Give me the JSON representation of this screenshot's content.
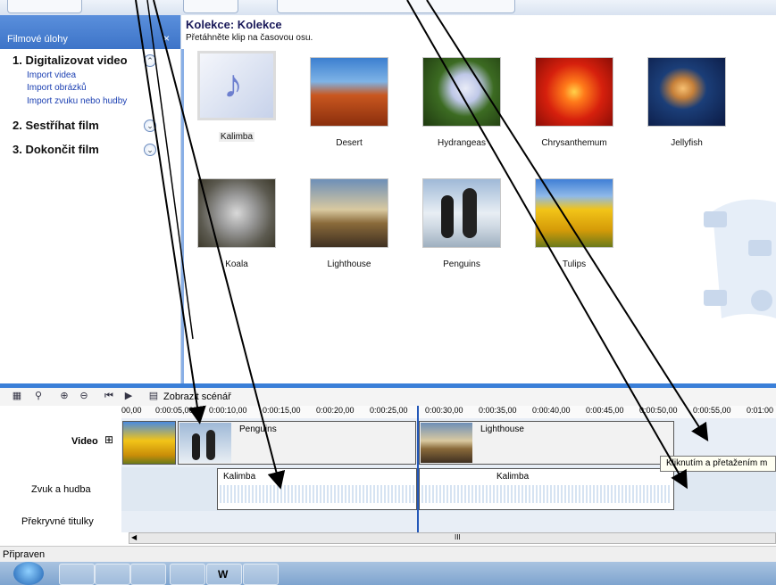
{
  "task_pane": {
    "header": "Filmové úlohy",
    "close": "×",
    "sections": [
      {
        "title": "1. Digitalizovat video",
        "toggle": "⌃",
        "links": [
          "Import videa",
          "Import obrázků",
          "Import zvuku nebo hudby"
        ]
      },
      {
        "title": "2. Sestříhat film",
        "toggle": "⌄"
      },
      {
        "title": "3. Dokončit film",
        "toggle": "⌄"
      }
    ]
  },
  "collection": {
    "title": "Kolekce: Kolekce",
    "subtitle": "Přetáhněte klip na časovou osu.",
    "clips": [
      "Kalimba",
      "Desert",
      "Hydrangeas",
      "Chrysanthemum",
      "Jellyfish",
      "Koala",
      "Lighthouse",
      "Penguins",
      "Tulips"
    ]
  },
  "timeline": {
    "show_storyboard": "Zobrazit scénář",
    "ruler_ticks": [
      "00,00",
      "0:00:05,00",
      "0:00:10,00",
      "0:00:15,00",
      "0:00:20,00",
      "0:00:25,00",
      "0:00:30,00",
      "0:00:35,00",
      "0:00:40,00",
      "0:00:45,00",
      "0:00:50,00",
      "0:00:55,00",
      "0:01:00"
    ],
    "tracks": {
      "video": "Video",
      "video_toggle": "⊞",
      "audio": "Zvuk a hudba",
      "titles": "Překryvné titulky"
    },
    "video_clips": [
      "Penguins",
      "Lighthouse"
    ],
    "audio_clips": [
      "Kalimba",
      "Kalimba"
    ],
    "scroll_grip": "III",
    "scroll_left": "◀"
  },
  "tooltip": "Kliknutím a přetažením m",
  "status": "Připraven",
  "taskbar": {
    "word": "W"
  },
  "colors": {
    "accent": "#3a7fd8",
    "link": "#1b3fb2",
    "task_header": "#4a82d4"
  }
}
